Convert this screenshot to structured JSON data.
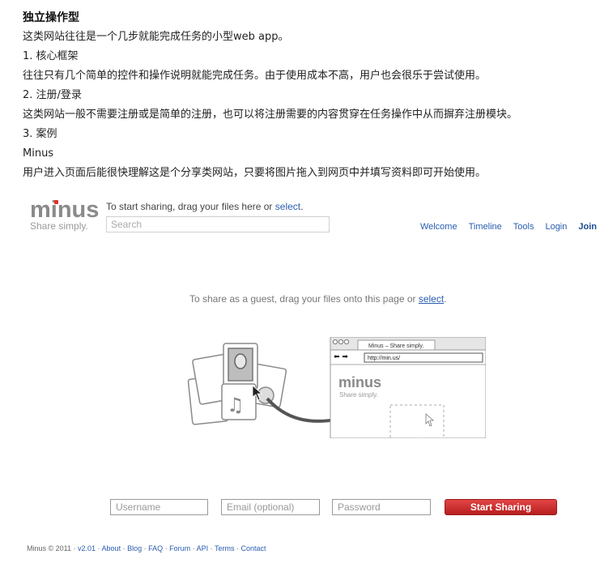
{
  "article": {
    "title": "独立操作型",
    "intro": "这类网站往往是一个几步就能完成任务的小型web app。",
    "s1_heading": "1.  核心框架",
    "s1_text": "往往只有几个简单的控件和操作说明就能完成任务。由于使用成本不高，用户也会很乐于尝试使用。",
    "s2_heading": "2. 注册/登录",
    "s2_text": "这类网站一般不需要注册或是简单的注册，也可以将注册需要的内容贯穿在任务操作中从而摒弃注册模块。",
    "s3_heading": "3. 案例",
    "case_name": "Minus",
    "case_text": "用户进入页面后能很快理解这是个分享类网站，只要将图片拖入到网页中并填写资料即可开始使用。"
  },
  "minus": {
    "logo": "minus",
    "tagline": "Share simply.",
    "top_prompt": "To start sharing, drag your files here or ",
    "top_prompt_link": "select",
    "top_prompt_end": ".",
    "search_placeholder": "Search",
    "nav": {
      "welcome": "Welcome",
      "timeline": "Timeline",
      "tools": "Tools",
      "login": "Login",
      "join": "Join"
    },
    "guest_prompt": "To share as a guest, drag your files onto this page or ",
    "guest_link": "select",
    "guest_end": ".",
    "illustration": {
      "browser_tab": "Minus – Share simply.",
      "browser_url": "http://min.us/",
      "browser_logo": "minus",
      "browser_tagline": "Share simply."
    },
    "form": {
      "username_placeholder": "Username",
      "email_placeholder": "Email (optional)",
      "password_placeholder": "Password",
      "submit": "Start Sharing"
    },
    "footer": {
      "copyright": "Minus © 2011 · ",
      "version": "v2.01",
      "about": "About",
      "blog": "Blog",
      "faq": "FAQ",
      "forum": "Forum",
      "api": "API",
      "terms": "Terms",
      "contact": "Contact",
      "sep": " · "
    }
  }
}
